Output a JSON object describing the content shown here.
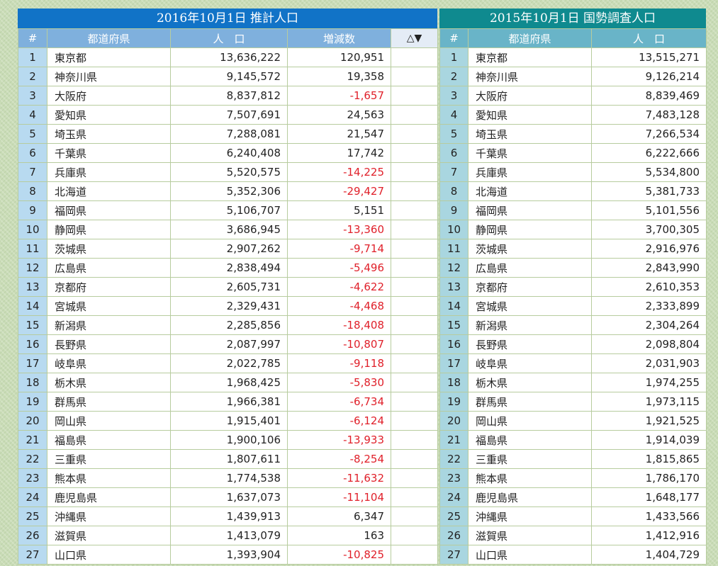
{
  "left": {
    "title": "2016年10月1日 推計人口",
    "headers": {
      "num": "#",
      "pref": "都道府県",
      "pop": "人　口",
      "change": "増減数",
      "sort": "△▼"
    },
    "rows": [
      {
        "n": "1",
        "pref": "東京都",
        "pop": "13,636,222",
        "change": "120,951"
      },
      {
        "n": "2",
        "pref": "神奈川県",
        "pop": "9,145,572",
        "change": "19,358"
      },
      {
        "n": "3",
        "pref": "大阪府",
        "pop": "8,837,812",
        "change": "-1,657"
      },
      {
        "n": "4",
        "pref": "愛知県",
        "pop": "7,507,691",
        "change": "24,563"
      },
      {
        "n": "5",
        "pref": "埼玉県",
        "pop": "7,288,081",
        "change": "21,547"
      },
      {
        "n": "6",
        "pref": "千葉県",
        "pop": "6,240,408",
        "change": "17,742"
      },
      {
        "n": "7",
        "pref": "兵庫県",
        "pop": "5,520,575",
        "change": "-14,225"
      },
      {
        "n": "8",
        "pref": "北海道",
        "pop": "5,352,306",
        "change": "-29,427"
      },
      {
        "n": "9",
        "pref": "福岡県",
        "pop": "5,106,707",
        "change": "5,151"
      },
      {
        "n": "10",
        "pref": "静岡県",
        "pop": "3,686,945",
        "change": "-13,360"
      },
      {
        "n": "11",
        "pref": "茨城県",
        "pop": "2,907,262",
        "change": "-9,714"
      },
      {
        "n": "12",
        "pref": "広島県",
        "pop": "2,838,494",
        "change": "-5,496"
      },
      {
        "n": "13",
        "pref": "京都府",
        "pop": "2,605,731",
        "change": "-4,622"
      },
      {
        "n": "14",
        "pref": "宮城県",
        "pop": "2,329,431",
        "change": "-4,468"
      },
      {
        "n": "15",
        "pref": "新潟県",
        "pop": "2,285,856",
        "change": "-18,408"
      },
      {
        "n": "16",
        "pref": "長野県",
        "pop": "2,087,997",
        "change": "-10,807"
      },
      {
        "n": "17",
        "pref": "岐阜県",
        "pop": "2,022,785",
        "change": "-9,118"
      },
      {
        "n": "18",
        "pref": "栃木県",
        "pop": "1,968,425",
        "change": "-5,830"
      },
      {
        "n": "19",
        "pref": "群馬県",
        "pop": "1,966,381",
        "change": "-6,734"
      },
      {
        "n": "20",
        "pref": "岡山県",
        "pop": "1,915,401",
        "change": "-6,124"
      },
      {
        "n": "21",
        "pref": "福島県",
        "pop": "1,900,106",
        "change": "-13,933"
      },
      {
        "n": "22",
        "pref": "三重県",
        "pop": "1,807,611",
        "change": "-8,254"
      },
      {
        "n": "23",
        "pref": "熊本県",
        "pop": "1,774,538",
        "change": "-11,632"
      },
      {
        "n": "24",
        "pref": "鹿児島県",
        "pop": "1,637,073",
        "change": "-11,104"
      },
      {
        "n": "25",
        "pref": "沖縄県",
        "pop": "1,439,913",
        "change": "6,347"
      },
      {
        "n": "26",
        "pref": "滋賀県",
        "pop": "1,413,079",
        "change": "163"
      },
      {
        "n": "27",
        "pref": "山口県",
        "pop": "1,393,904",
        "change": "-10,825"
      }
    ]
  },
  "right": {
    "title": "2015年10月1日 国勢調査人口",
    "headers": {
      "num": "#",
      "pref": "都道府県",
      "pop": "人　口"
    },
    "rows": [
      {
        "n": "1",
        "pref": "東京都",
        "pop": "13,515,271"
      },
      {
        "n": "2",
        "pref": "神奈川県",
        "pop": "9,126,214"
      },
      {
        "n": "3",
        "pref": "大阪府",
        "pop": "8,839,469"
      },
      {
        "n": "4",
        "pref": "愛知県",
        "pop": "7,483,128"
      },
      {
        "n": "5",
        "pref": "埼玉県",
        "pop": "7,266,534"
      },
      {
        "n": "6",
        "pref": "千葉県",
        "pop": "6,222,666"
      },
      {
        "n": "7",
        "pref": "兵庫県",
        "pop": "5,534,800"
      },
      {
        "n": "8",
        "pref": "北海道",
        "pop": "5,381,733"
      },
      {
        "n": "9",
        "pref": "福岡県",
        "pop": "5,101,556"
      },
      {
        "n": "10",
        "pref": "静岡県",
        "pop": "3,700,305"
      },
      {
        "n": "11",
        "pref": "茨城県",
        "pop": "2,916,976"
      },
      {
        "n": "12",
        "pref": "広島県",
        "pop": "2,843,990"
      },
      {
        "n": "13",
        "pref": "京都府",
        "pop": "2,610,353"
      },
      {
        "n": "14",
        "pref": "宮城県",
        "pop": "2,333,899"
      },
      {
        "n": "15",
        "pref": "新潟県",
        "pop": "2,304,264"
      },
      {
        "n": "16",
        "pref": "長野県",
        "pop": "2,098,804"
      },
      {
        "n": "17",
        "pref": "岐阜県",
        "pop": "2,031,903"
      },
      {
        "n": "18",
        "pref": "栃木県",
        "pop": "1,974,255"
      },
      {
        "n": "19",
        "pref": "群馬県",
        "pop": "1,973,115"
      },
      {
        "n": "20",
        "pref": "岡山県",
        "pop": "1,921,525"
      },
      {
        "n": "21",
        "pref": "福島県",
        "pop": "1,914,039"
      },
      {
        "n": "22",
        "pref": "三重県",
        "pop": "1,815,865"
      },
      {
        "n": "23",
        "pref": "熊本県",
        "pop": "1,786,170"
      },
      {
        "n": "24",
        "pref": "鹿児島県",
        "pop": "1,648,177"
      },
      {
        "n": "25",
        "pref": "沖縄県",
        "pop": "1,433,566"
      },
      {
        "n": "26",
        "pref": "滋賀県",
        "pop": "1,412,916"
      },
      {
        "n": "27",
        "pref": "山口県",
        "pop": "1,404,729"
      }
    ]
  },
  "colors": {
    "left_title_bg": "#1173c7",
    "right_title_bg": "#0f8a8f",
    "negative_text": "#e0202a",
    "page_bg": "#c9dcb6"
  }
}
